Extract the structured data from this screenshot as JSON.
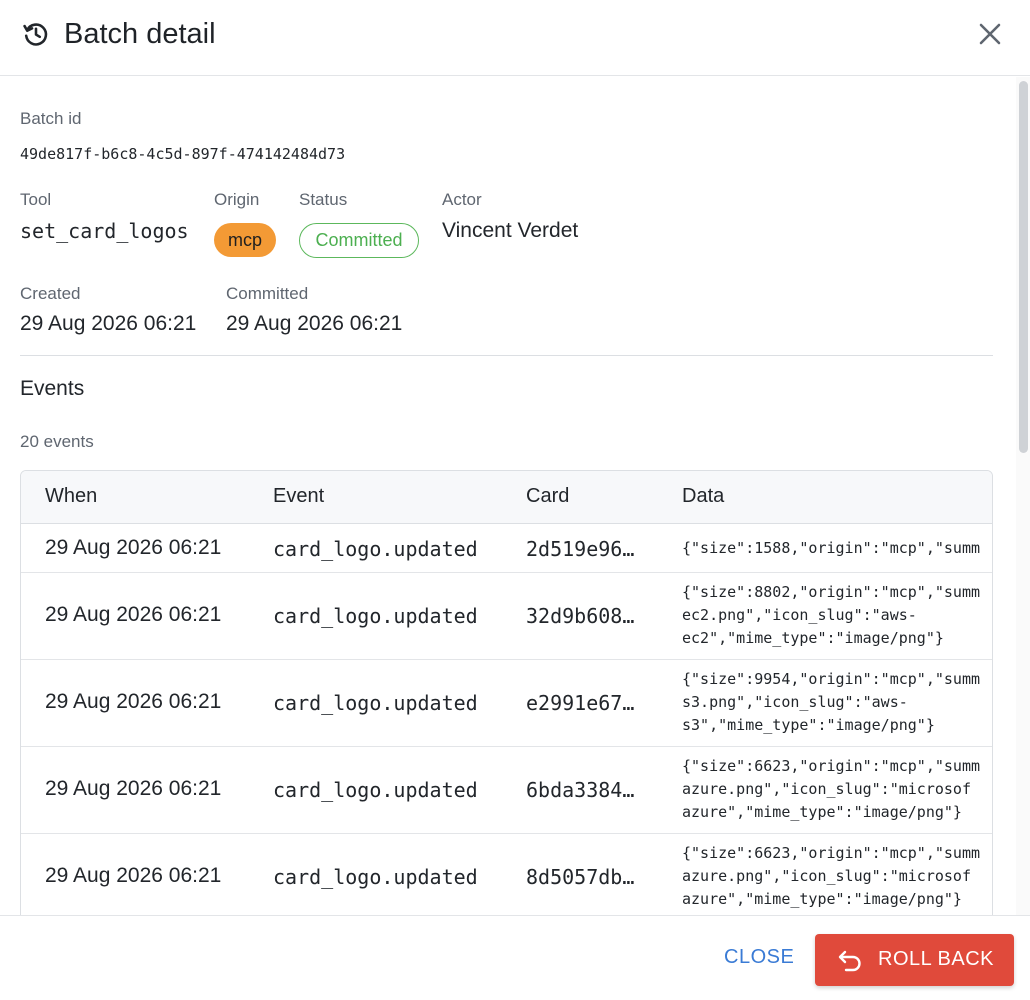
{
  "header": {
    "title": "Batch detail",
    "icon": "history-icon",
    "close_icon": "close-icon"
  },
  "batch": {
    "id_label": "Batch id",
    "id_value": "49de817f-b6c8-4c5d-897f-474142484d73",
    "tool_label": "Tool",
    "tool_value": "set_card_logos",
    "origin_label": "Origin",
    "origin_value": "mcp",
    "status_label": "Status",
    "status_value": "Committed",
    "actor_label": "Actor",
    "actor_value": "Vincent Verdet",
    "created_label": "Created",
    "created_value": "29 Aug 2026 06:21",
    "committed_label": "Committed",
    "committed_value": "29 Aug 2026 06:21"
  },
  "events": {
    "title": "Events",
    "count_text": "20 events",
    "columns": [
      "When",
      "Event",
      "Card",
      "Data"
    ],
    "rows": [
      {
        "when": "29 Aug 2026 06:21",
        "event": "card_logo.updated",
        "card": "2d519e96…",
        "data": "{\"size\":1588,\"origin\":\"mcp\",\"summ"
      },
      {
        "when": "29 Aug 2026 06:21",
        "event": "card_logo.updated",
        "card": "32d9b608…",
        "data": "{\"size\":8802,\"origin\":\"mcp\",\"summ\nec2.png\",\"icon_slug\":\"aws-\nec2\",\"mime_type\":\"image/png\"}"
      },
      {
        "when": "29 Aug 2026 06:21",
        "event": "card_logo.updated",
        "card": "e2991e67…",
        "data": "{\"size\":9954,\"origin\":\"mcp\",\"summ\ns3.png\",\"icon_slug\":\"aws-\ns3\",\"mime_type\":\"image/png\"}"
      },
      {
        "when": "29 Aug 2026 06:21",
        "event": "card_logo.updated",
        "card": "6bda3384…",
        "data": "{\"size\":6623,\"origin\":\"mcp\",\"summ\nazure.png\",\"icon_slug\":\"microsof\nazure\",\"mime_type\":\"image/png\"}"
      },
      {
        "when": "29 Aug 2026 06:21",
        "event": "card_logo.updated",
        "card": "8d5057db…",
        "data": "{\"size\":6623,\"origin\":\"mcp\",\"summ\nazure.png\",\"icon_slug\":\"microsof\nazure\",\"mime_type\":\"image/png\"}"
      }
    ]
  },
  "footer": {
    "close_label": "CLOSE",
    "rollback_label": "ROLL BACK",
    "rollback_icon": "undo-icon"
  },
  "colors": {
    "origin_chip": "#f39a35",
    "status_green": "#4caf50",
    "rollback_red": "#e04a3b",
    "link_blue": "#3a7bd5"
  }
}
